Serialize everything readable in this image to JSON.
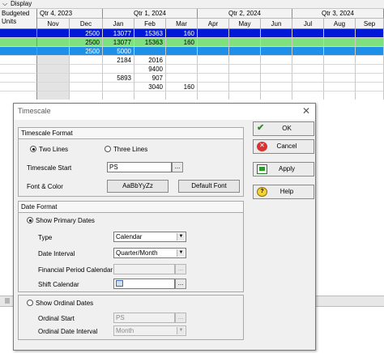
{
  "topbar": {
    "label": "Display"
  },
  "grid": {
    "corner_label_line1": "Budgeted",
    "corner_label_line2": "Units",
    "quarters": [
      "Qtr 4, 2023",
      "Qtr 1, 2024",
      "Qtr 2, 2024",
      "Qtr 3, 2024"
    ],
    "months": [
      "Nov",
      "Dec",
      "Jan",
      "Feb",
      "Mar",
      "Apr",
      "May",
      "Jun",
      "Jul",
      "Aug",
      "Sep"
    ],
    "rows": [
      {
        "style": "blue",
        "cells": [
          "",
          "2500",
          "13077",
          "15363",
          "160",
          "",
          "",
          "",
          "",
          "",
          ""
        ]
      },
      {
        "style": "green",
        "cells": [
          "",
          "2500",
          "13077",
          "15363",
          "160",
          "",
          "",
          "",
          "",
          "",
          ""
        ]
      },
      {
        "style": "lightblue",
        "cells": [
          "",
          "2500",
          "5000",
          "",
          "",
          "",
          "",
          "",
          "",
          "",
          ""
        ]
      },
      {
        "style": "plain",
        "cells": [
          "",
          "",
          "2184",
          "2016",
          "",
          "",
          "",
          "",
          "",
          "",
          ""
        ]
      },
      {
        "style": "plain",
        "cells": [
          "",
          "",
          "",
          "9400",
          "",
          "",
          "",
          "",
          "",
          "",
          ""
        ]
      },
      {
        "style": "plain",
        "cells": [
          "",
          "",
          "5893",
          "907",
          "",
          "",
          "",
          "",
          "",
          "",
          ""
        ]
      },
      {
        "style": "plain",
        "cells": [
          "",
          "",
          "",
          "3040",
          "160",
          "",
          "",
          "",
          "",
          "",
          ""
        ]
      },
      {
        "style": "plain",
        "cells": [
          "",
          "",
          "",
          "",
          "",
          "",
          "",
          "",
          "",
          "",
          ""
        ]
      }
    ],
    "colors": {
      "blue": "#0019d9",
      "green": "#7fe07f",
      "lightblue": "#1e90e8"
    }
  },
  "dialog": {
    "title": "Timescale",
    "timescale_format": {
      "header": "Timescale Format",
      "two_lines": "Two Lines",
      "three_lines": "Three Lines",
      "start_label": "Timescale Start",
      "start_value": "PS",
      "font_label": "Font & Color",
      "font_sample": "AaBbYyZz",
      "default_font": "Default Font"
    },
    "date_format": {
      "header": "Date Format",
      "show_primary": "Show Primary Dates",
      "type_label": "Type",
      "type_value": "Calendar",
      "interval_label": "Date Interval",
      "interval_value": "Quarter/Month",
      "fin_label": "Financial Period Calendar",
      "shift_label": "Shift Calendar",
      "show_ordinal": "Show Ordinal Dates",
      "ord_start_label": "Ordinal Start",
      "ord_start_value": "PS",
      "ord_interval_label": "Ordinal Date Interval",
      "ord_interval_value": "Month"
    },
    "buttons": {
      "ok": "OK",
      "cancel": "Cancel",
      "apply": "Apply",
      "help": "Help"
    }
  }
}
